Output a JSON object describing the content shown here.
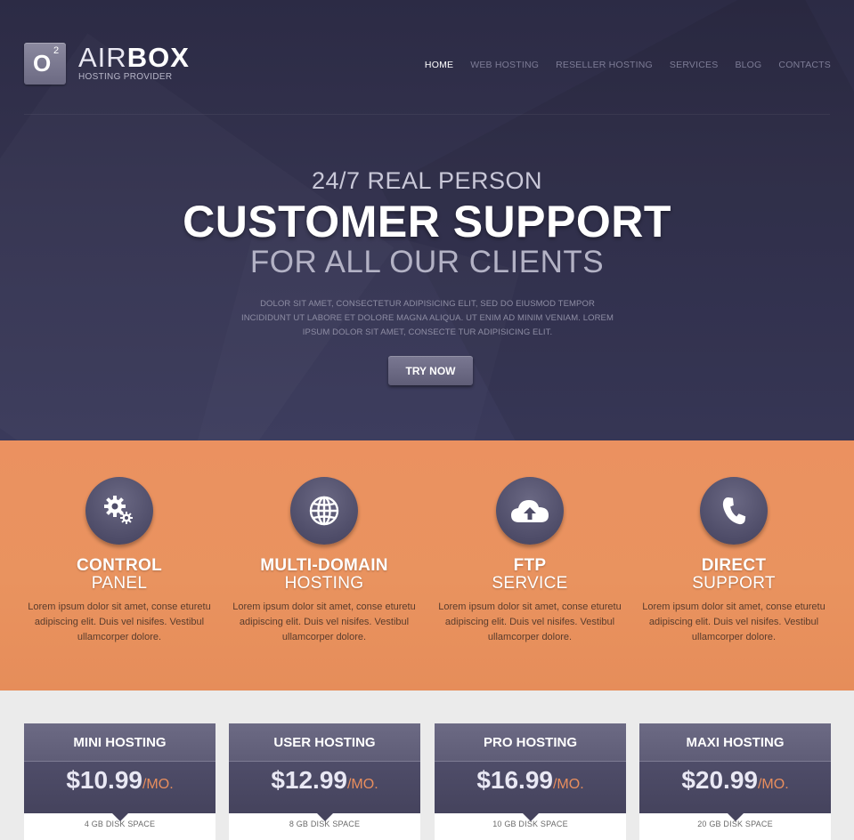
{
  "brand": {
    "logo_letter": "O",
    "logo_superscript": "2",
    "name_thin": "AIR",
    "name_bold": "BOX",
    "tagline": "HOSTING PROVIDER"
  },
  "nav": [
    {
      "label": "HOME",
      "active": true
    },
    {
      "label": "WEB HOSTING",
      "active": false
    },
    {
      "label": "RESELLER HOSTING",
      "active": false
    },
    {
      "label": "SERVICES",
      "active": false
    },
    {
      "label": "BLOG",
      "active": false
    },
    {
      "label": "CONTACTS",
      "active": false
    }
  ],
  "hero": {
    "line1": "24/7 REAL PERSON",
    "line2": "CUSTOMER SUPPORT",
    "line3": "FOR ALL OUR CLIENTS",
    "paragraph": "DOLOR SIT AMET, CONSECTETUR ADIPISICING ELIT, SED DO EIUSMOD TEMPOR INCIDIDUNT UT LABORE ET DOLORE MAGNA ALIQUA. UT ENIM AD MINIM VENIAM. LOREM IPSUM DOLOR SIT AMET, CONSECTE TUR ADIPISICING ELIT.",
    "button_label": "TRY NOW"
  },
  "features": [
    {
      "icon": "gears-icon",
      "title1": "CONTROL",
      "title2": "PANEL",
      "text": "Lorem ipsum dolor sit amet, conse eturetu adipiscing elit. Duis vel nisifes. Vestibul ullamcorper dolore."
    },
    {
      "icon": "globe-icon",
      "title1": "MULTI-DOMAIN",
      "title2": "HOSTING",
      "text": "Lorem ipsum dolor sit amet, conse eturetu adipiscing elit. Duis vel nisifes. Vestibul ullamcorper dolore."
    },
    {
      "icon": "cloud-upload-icon",
      "title1": "FTP",
      "title2": "SERVICE",
      "text": "Lorem ipsum dolor sit amet, conse eturetu adipiscing elit. Duis vel nisifes. Vestibul ullamcorper dolore."
    },
    {
      "icon": "phone-icon",
      "title1": "DIRECT",
      "title2": "SUPPORT",
      "text": "Lorem ipsum dolor sit amet, conse eturetu adipiscing elit. Duis vel nisifes. Vestibul ullamcorper dolore."
    }
  ],
  "plans": [
    {
      "name": "MINI HOSTING",
      "price": "$10.99",
      "period": "/MO.",
      "feature": "4 GB DISK SPACE"
    },
    {
      "name": "USER HOSTING",
      "price": "$12.99",
      "period": "/MO.",
      "feature": "8 GB DISK SPACE"
    },
    {
      "name": "PRO HOSTING",
      "price": "$16.99",
      "period": "/MO.",
      "feature": "10 GB DISK SPACE"
    },
    {
      "name": "MAXI HOSTING",
      "price": "$20.99",
      "period": "/MO.",
      "feature": "20 GB DISK SPACE"
    }
  ],
  "colors": {
    "hero_bg": "#2f2e48",
    "accent_orange": "#e9935f",
    "purple": "#5f5d77"
  }
}
